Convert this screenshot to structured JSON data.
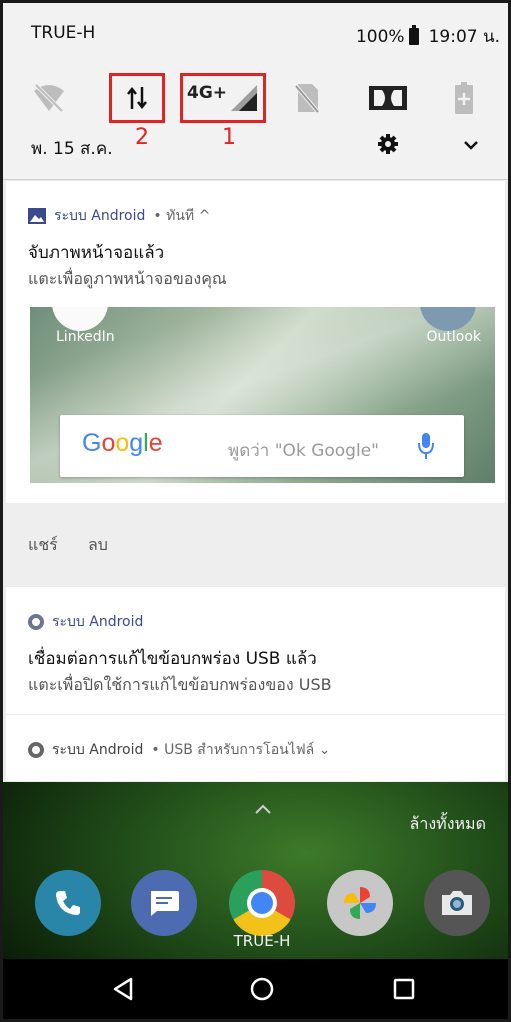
{
  "status_bar": {
    "carrier": "TRUE-H",
    "battery": "100%",
    "time": "19:07 น."
  },
  "quick_settings": {
    "network_type": "4G+",
    "markers": {
      "data_toggle": "2",
      "network_tile": "1"
    },
    "date": "พ. 15 ส.ค.",
    "icons": [
      "wifi-off-icon",
      "mobile-data-icon",
      "signal-4g-icon",
      "no-sim-icon",
      "dolby-icon",
      "battery-saver-icon",
      "gear-icon",
      "chevron-down-icon"
    ]
  },
  "notifications": [
    {
      "app": "ระบบ Android",
      "meta": "• ทันที ^",
      "title": "จับภาพหน้าจอแล้ว",
      "text": "แตะเพื่อดูภาพหน้าจอของคุณ",
      "preview": {
        "left_label": "LinkedIn",
        "right_label": "Outlook",
        "google_logo": "Google",
        "search_hint": "พูดว่า \"Ok Google\""
      },
      "actions": [
        "แชร์",
        "ลบ"
      ]
    },
    {
      "app": "ระบบ Android",
      "title": "เชื่อมต่อการแก้ไขข้อบกพร่อง USB แล้ว",
      "text": "แตะเพื่อปิดใช้การแก้ไขข้อบกพร่องของ USB"
    },
    {
      "app": "ระบบ Android",
      "meta": "• USB สำหรับการโอนไฟล์ ⌄"
    }
  ],
  "home": {
    "clear_all": "ล้างทั้งหมด",
    "dock_label": "TRUE-H"
  },
  "colors": {
    "accent": "#3b4a8f",
    "highlight": "#e02424"
  }
}
